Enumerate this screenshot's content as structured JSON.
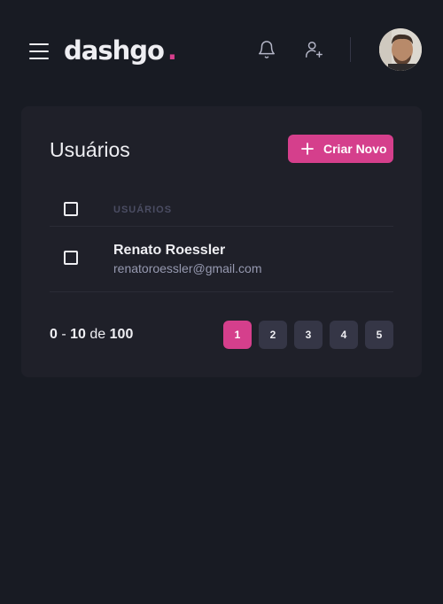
{
  "header": {
    "logo": "dashgo",
    "logo_dot": ".",
    "icons": [
      "menu-icon",
      "bell-icon",
      "user-plus-icon"
    ],
    "accent_color": "#d53f8c"
  },
  "card": {
    "title": "Usuários",
    "create_button_label": "Criar Novo",
    "table": {
      "columns": [
        "USUÁRIOS"
      ],
      "rows": [
        {
          "name": "Renato Roessler",
          "email": "renatoroessler@gmail.com"
        }
      ]
    },
    "pagination": {
      "from": "0",
      "to": "10",
      "separator": "-",
      "of_label": "de",
      "total": "100",
      "pages": [
        "1",
        "2",
        "3",
        "4",
        "5"
      ],
      "current_page": "1"
    }
  }
}
